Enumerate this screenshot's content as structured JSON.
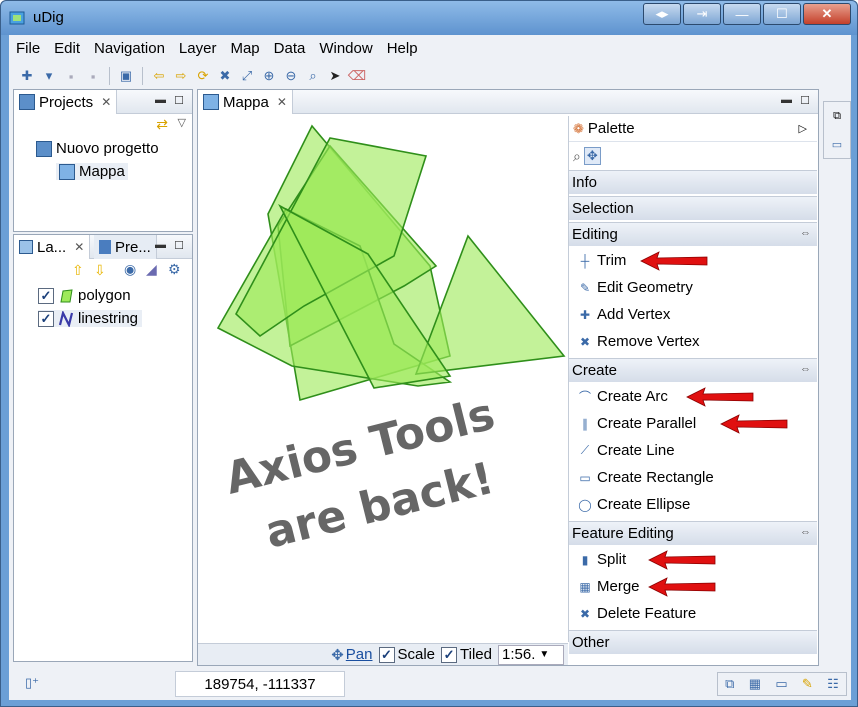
{
  "window": {
    "title": "uDig",
    "buttons": [
      "◂▸",
      "⇥",
      "—",
      "☐",
      "✕"
    ]
  },
  "menu": [
    "File",
    "Edit",
    "Navigation",
    "Layer",
    "Map",
    "Data",
    "Window",
    "Help"
  ],
  "projects_view": {
    "tab_label": "Projects",
    "items": [
      {
        "label": "Nuovo progetto",
        "icon": "project-icon"
      },
      {
        "label": "Mappa",
        "icon": "map-icon"
      }
    ]
  },
  "layers_view": {
    "tabs": [
      "La...",
      "Pre..."
    ],
    "layers": [
      {
        "label": "polygon",
        "checked": true,
        "icon": "polygon-icon"
      },
      {
        "label": "linestring",
        "checked": true,
        "icon": "linestring-icon"
      }
    ]
  },
  "map_editor": {
    "tab_label": "Mappa",
    "overlay_text": [
      "Axios Tools",
      "are back!"
    ],
    "status": {
      "pan_label": "Pan",
      "scale_label": "Scale",
      "tiled_label": "Tiled",
      "scale_value": "1:56."
    }
  },
  "palette": {
    "title": "Palette",
    "drawers": [
      {
        "label": "Info",
        "items": []
      },
      {
        "label": "Selection",
        "items": []
      },
      {
        "label": "Editing",
        "items": [
          "Trim",
          "Edit Geometry",
          "Add Vertex",
          "Remove Vertex"
        ]
      },
      {
        "label": "Create",
        "items": [
          "Create Arc",
          "Create Parallel",
          "Create Line",
          "Create Rectangle",
          "Create Ellipse"
        ]
      },
      {
        "label": "Feature Editing",
        "items": [
          "Split",
          "Merge",
          "Delete Feature"
        ]
      },
      {
        "label": "Other",
        "items": []
      }
    ]
  },
  "statusbar": {
    "coordinates": "189754, -111337"
  },
  "colors": {
    "polygon_fill": "#9eea5a",
    "polygon_stroke": "#2f8f1a",
    "arrow_red": "#e01010",
    "text_overlay": "#666666"
  }
}
